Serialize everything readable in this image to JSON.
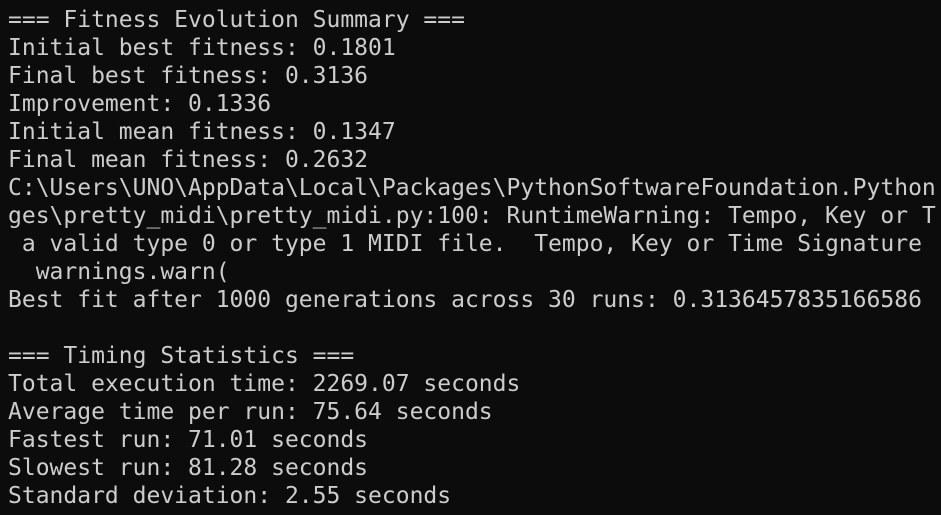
{
  "terminal": {
    "text_color": "#cccccc",
    "background_color": "#0c0c0c",
    "lines": [
      "=== Fitness Evolution Summary ===",
      "Initial best fitness: 0.1801",
      "Final best fitness: 0.3136",
      "Improvement: 0.1336",
      "Initial mean fitness: 0.1347",
      "Final mean fitness: 0.2632",
      "C:\\Users\\UNO\\AppData\\Local\\Packages\\PythonSoftwareFoundation.Python",
      "ges\\pretty_midi\\pretty_midi.py:100: RuntimeWarning: Tempo, Key or T",
      " a valid type 0 or type 1 MIDI file.  Tempo, Key or Time Signature",
      "  warnings.warn(",
      "Best fit after 1000 generations across 30 runs: 0.3136457835166586",
      "",
      "=== Timing Statistics ===",
      "Total execution time: 2269.07 seconds",
      "Average time per run: 75.64 seconds",
      "Fastest run: 71.01 seconds",
      "Slowest run: 81.28 seconds",
      "Standard deviation: 2.55 seconds"
    ]
  }
}
